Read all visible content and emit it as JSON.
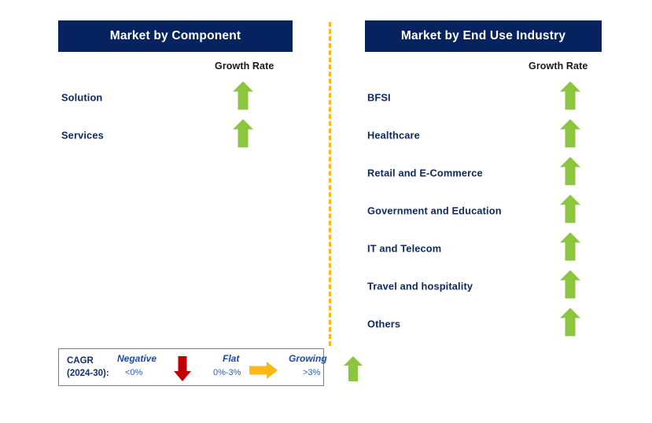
{
  "diagram": {
    "columns": [
      {
        "id": "market-by-component",
        "title": "Market by Component",
        "growth_caption": "Growth Rate",
        "items": [
          {
            "label": "Solution",
            "growth": "growing",
            "icon": "up-arrow-icon"
          },
          {
            "label": "Services",
            "growth": "growing",
            "icon": "up-arrow-icon"
          }
        ]
      },
      {
        "id": "market-by-end-use-industry",
        "title": "Market by End Use Industry",
        "growth_caption": "Growth Rate",
        "items": [
          {
            "label": "BFSI",
            "growth": "growing",
            "icon": "up-arrow-icon"
          },
          {
            "label": "Healthcare",
            "growth": "growing",
            "icon": "up-arrow-icon"
          },
          {
            "label": "Retail and E-Commerce",
            "growth": "growing",
            "icon": "up-arrow-icon"
          },
          {
            "label": "Government and Education",
            "growth": "growing",
            "icon": "up-arrow-icon"
          },
          {
            "label": "IT and Telecom",
            "growth": "growing",
            "icon": "up-arrow-icon"
          },
          {
            "label": "Travel and hospitality",
            "growth": "growing",
            "icon": "up-arrow-icon"
          },
          {
            "label": "Others",
            "growth": "growing",
            "icon": "up-arrow-icon"
          }
        ]
      }
    ],
    "divider": {
      "style": "dashed",
      "orientation": "vertical",
      "color": "#ffb812"
    }
  },
  "legend": {
    "title_line1": "CAGR",
    "title_line2": "(2024-30):",
    "items": [
      {
        "term": "Negative",
        "range": "<0%",
        "icon": "down-arrow-icon",
        "color": "#c00000"
      },
      {
        "term": "Flat",
        "range": "0%-3%",
        "icon": "right-arrow-icon",
        "color": "#ffb812"
      },
      {
        "term": "Growing",
        "range": ">3%",
        "icon": "up-arrow-icon",
        "color": "#8cc63e"
      }
    ]
  },
  "colors": {
    "header_navy": "#062360",
    "label_navy": "#0d2a63",
    "growth_green": "#8cc63e",
    "negative_red": "#c00000",
    "flat_orange": "#ffb812",
    "legend_border": "#808080"
  }
}
